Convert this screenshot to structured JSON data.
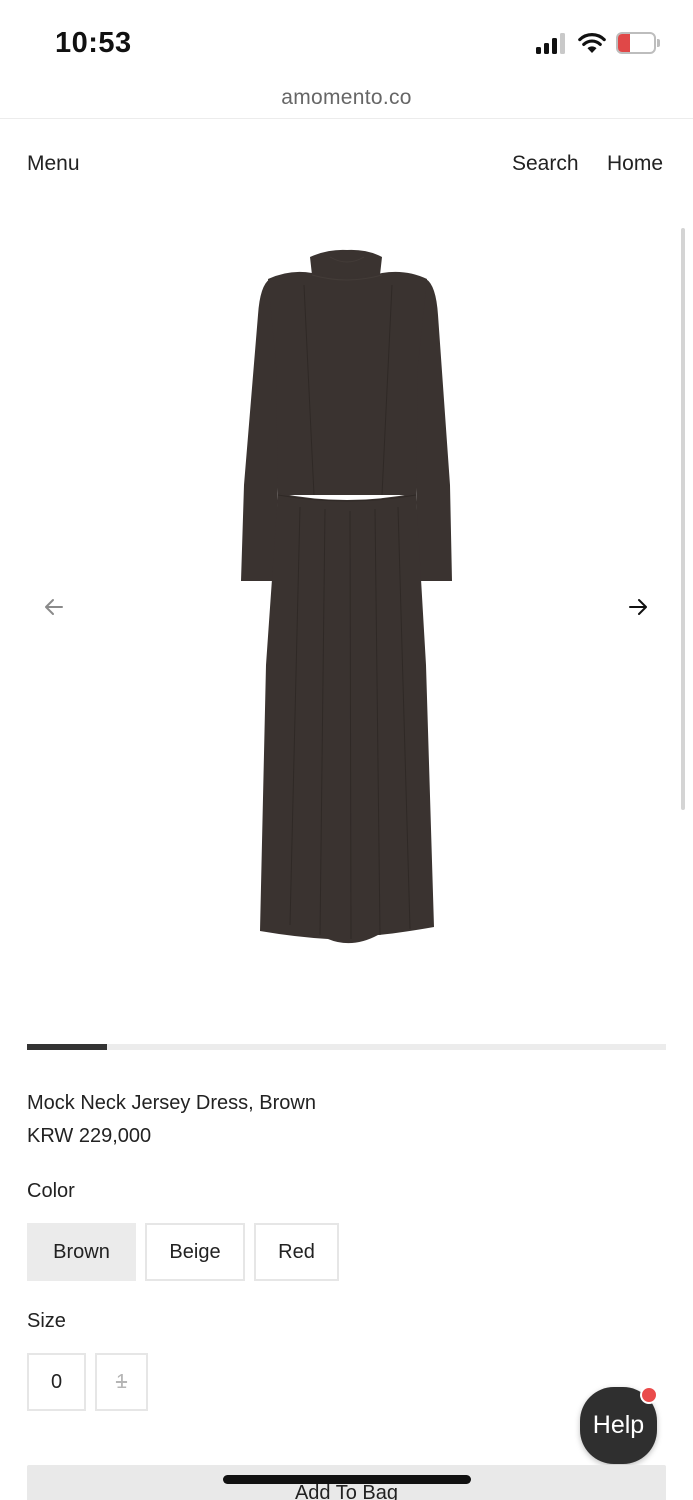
{
  "status_bar": {
    "time": "10:53",
    "battery_level": "9",
    "battery_color": "#e04848"
  },
  "browser": {
    "url": "amomento.co"
  },
  "nav": {
    "menu": "Menu",
    "search": "Search",
    "home": "Home"
  },
  "gallery": {
    "prev_icon": "arrow-left-icon",
    "next_icon": "arrow-right-icon",
    "image_color": "#3a3330",
    "progress_fraction": 0.125
  },
  "product": {
    "name": "Mock Neck Jersey Dress, Brown",
    "price": "KRW 229,000"
  },
  "color": {
    "label": "Color",
    "options": [
      {
        "label": "Brown",
        "selected": true
      },
      {
        "label": "Beige",
        "selected": false
      },
      {
        "label": "Red",
        "selected": false
      }
    ]
  },
  "size": {
    "label": "Size",
    "options": [
      {
        "label": "0",
        "available": true
      },
      {
        "label": "1",
        "available": false
      }
    ]
  },
  "help": {
    "label": "Help",
    "badge_color": "#ea4b4b"
  },
  "cta": {
    "add_to_bag": "Add To Bag"
  }
}
